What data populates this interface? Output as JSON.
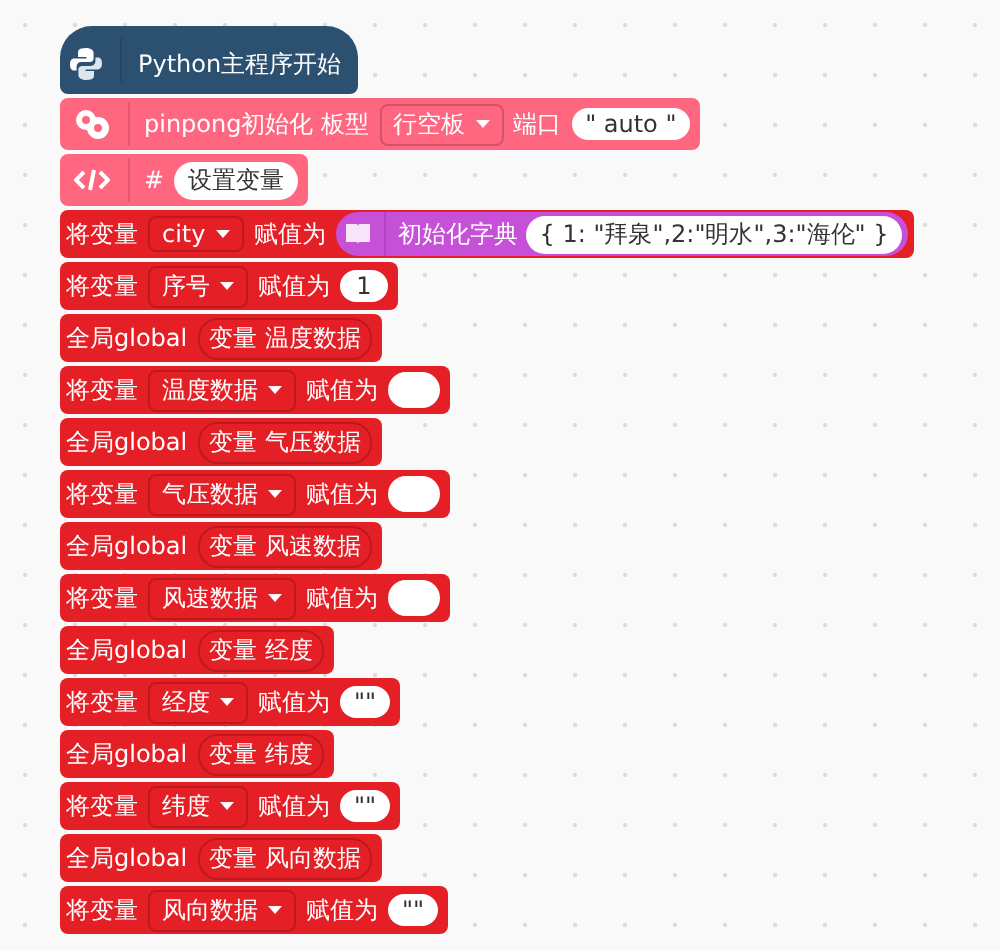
{
  "main": {
    "title": "Python主程序开始"
  },
  "blocks": [
    {
      "kind": "pinpong",
      "parts": [
        {
          "kind": "text",
          "text": "pinpong初始化 板型"
        },
        {
          "kind": "dropdown",
          "text": "行空板"
        },
        {
          "kind": "text",
          "text": "端口"
        },
        {
          "kind": "value",
          "text": "\" auto \""
        }
      ]
    },
    {
      "kind": "comment",
      "parts": [
        {
          "kind": "text",
          "text": "#"
        },
        {
          "kind": "value",
          "text": "设置变量"
        }
      ]
    },
    {
      "kind": "set",
      "parts": [
        {
          "kind": "text",
          "text": "将变量"
        },
        {
          "kind": "dropdown",
          "text": "city"
        },
        {
          "kind": "text",
          "text": "赋值为"
        },
        {
          "kind": "call",
          "text": "初始化字典",
          "value": "{ 1: \"拜泉\",2:\"明水\",3:\"海伦\" }"
        }
      ]
    },
    {
      "kind": "set",
      "parts": [
        {
          "kind": "text",
          "text": "将变量"
        },
        {
          "kind": "dropdown",
          "text": "序号"
        },
        {
          "kind": "text",
          "text": "赋值为"
        },
        {
          "kind": "value",
          "text": "1"
        }
      ]
    },
    {
      "kind": "global",
      "parts": [
        {
          "kind": "text",
          "text": "全局global"
        },
        {
          "kind": "field",
          "text": "变量 温度数据"
        }
      ]
    },
    {
      "kind": "set",
      "parts": [
        {
          "kind": "text",
          "text": "将变量"
        },
        {
          "kind": "dropdown",
          "text": "温度数据"
        },
        {
          "kind": "text",
          "text": "赋值为"
        },
        {
          "kind": "empty"
        }
      ]
    },
    {
      "kind": "global",
      "parts": [
        {
          "kind": "text",
          "text": "全局global"
        },
        {
          "kind": "field",
          "text": "变量 气压数据"
        }
      ]
    },
    {
      "kind": "set",
      "parts": [
        {
          "kind": "text",
          "text": "将变量"
        },
        {
          "kind": "dropdown",
          "text": "气压数据"
        },
        {
          "kind": "text",
          "text": "赋值为"
        },
        {
          "kind": "empty"
        }
      ]
    },
    {
      "kind": "global",
      "parts": [
        {
          "kind": "text",
          "text": "全局global"
        },
        {
          "kind": "field",
          "text": "变量 风速数据"
        }
      ]
    },
    {
      "kind": "set",
      "parts": [
        {
          "kind": "text",
          "text": "将变量"
        },
        {
          "kind": "dropdown",
          "text": "风速数据"
        },
        {
          "kind": "text",
          "text": "赋值为"
        },
        {
          "kind": "empty"
        }
      ]
    },
    {
      "kind": "global",
      "parts": [
        {
          "kind": "text",
          "text": "全局global"
        },
        {
          "kind": "field",
          "text": "变量 经度"
        }
      ]
    },
    {
      "kind": "set",
      "parts": [
        {
          "kind": "text",
          "text": "将变量"
        },
        {
          "kind": "dropdown",
          "text": "经度"
        },
        {
          "kind": "text",
          "text": "赋值为"
        },
        {
          "kind": "value",
          "text": "\"\""
        }
      ]
    },
    {
      "kind": "global",
      "parts": [
        {
          "kind": "text",
          "text": "全局global"
        },
        {
          "kind": "field",
          "text": "变量 纬度"
        }
      ]
    },
    {
      "kind": "set",
      "parts": [
        {
          "kind": "text",
          "text": "将变量"
        },
        {
          "kind": "dropdown",
          "text": "纬度"
        },
        {
          "kind": "text",
          "text": "赋值为"
        },
        {
          "kind": "value",
          "text": "\"\""
        }
      ]
    },
    {
      "kind": "global",
      "parts": [
        {
          "kind": "text",
          "text": "全局global"
        },
        {
          "kind": "field",
          "text": "变量 风向数据"
        }
      ]
    },
    {
      "kind": "set",
      "parts": [
        {
          "kind": "text",
          "text": "将变量"
        },
        {
          "kind": "dropdown",
          "text": "风向数据"
        },
        {
          "kind": "text",
          "text": "赋值为"
        },
        {
          "kind": "value",
          "text": "\"\""
        }
      ]
    }
  ]
}
